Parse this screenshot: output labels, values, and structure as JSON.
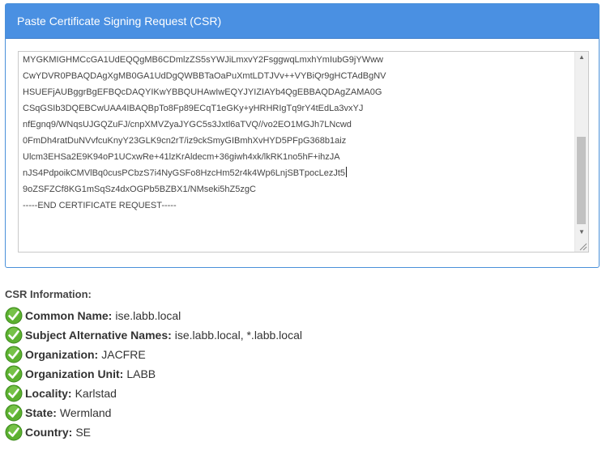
{
  "panel": {
    "title": "Paste Certificate Signing Request (CSR)"
  },
  "csr": {
    "lines": [
      "MYGKMIGHMCcGA1UdEQQgMB6CDmlzZS5sYWJiLmxvY2FsggwqLmxhYmIubG9jYWww",
      "CwYDVR0PBAQDAgXgMB0GA1UdDgQWBBTaOaPuXmtLDTJVv++VYBiQr9gHCTAdBgNV",
      "HSUEFjAUBggrBgEFBQcDAQYIKwYBBQUHAwIwEQYJYIZIAYb4QgEBBAQDAgZAMA0G",
      "CSqGSIb3DQEBCwUAA4IBAQBpTo8Fp89ECqT1eGKy+yHRHRIgTq9rY4tEdLa3vxYJ",
      "nfEgnq9/WNqsUJGQZuFJ/cnpXMVZyaJYGC5s3Jxtl6aTVQ//vo2EO1MGJh7LNcwd",
      "0FmDh4ratDuNVvfcuKnyY23GLK9cn2rT/iz9ckSmyGIBmhXvHYD5PFpG368b1aiz",
      "Ulcm3EHSa2E9K94oP1UCxwRe+41lzKrAldecm+36giwh4xk/lkRK1no5hF+ihzJA",
      "nJS4PdpoikCMVlBq0cusPCbzS7i4NyGSFo8HzcHm52r4k4Wp6LnjSBTpocLezJt5",
      "9oZSFZCf8KG1mSqSz4dxOGPb5BZBX1/NMseki5hZ5zgC",
      "-----END CERTIFICATE REQUEST-----"
    ]
  },
  "info": {
    "title": "CSR Information:",
    "items": [
      {
        "label": "Common Name:",
        "value": "ise.labb.local"
      },
      {
        "label": "Subject Alternative Names:",
        "value": "ise.labb.local, *.labb.local"
      },
      {
        "label": "Organization:",
        "value": "JACFRE"
      },
      {
        "label": "Organization Unit:",
        "value": "LABB"
      },
      {
        "label": "Locality:",
        "value": "Karlstad"
      },
      {
        "label": "State:",
        "value": "Wermland"
      },
      {
        "label": "Country:",
        "value": "SE"
      }
    ]
  },
  "icons": {
    "check": "check-circle-icon",
    "scroll_up": "scroll-up-arrow-icon",
    "scroll_down": "scroll-down-arrow-icon",
    "resize": "resize-grip-icon"
  },
  "colors": {
    "header_bg": "#4a90e2",
    "check_green": "#5cb030"
  }
}
